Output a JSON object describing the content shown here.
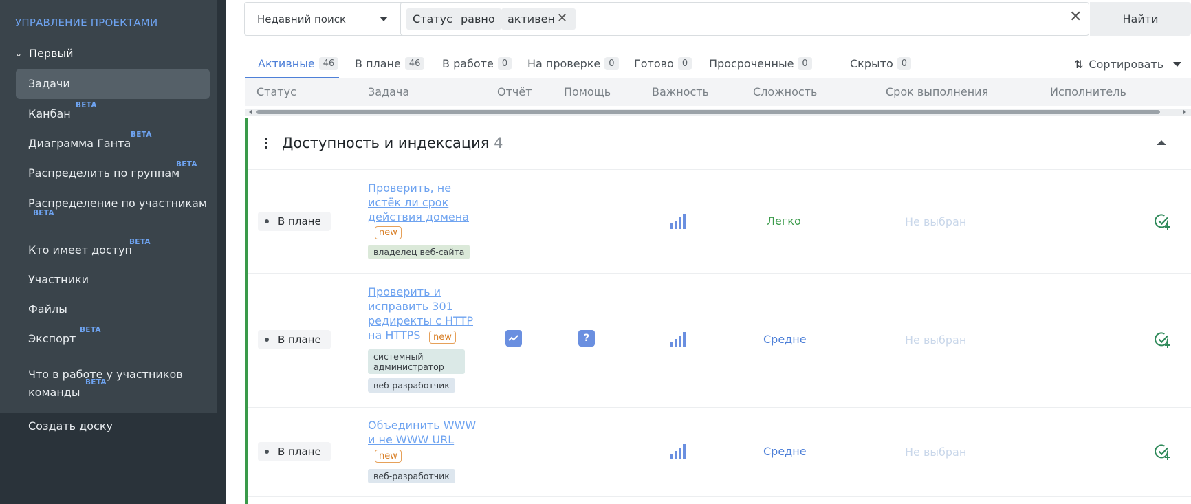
{
  "sidebar": {
    "title": "УПРАВЛЕНИЕ ПРОЕКТАМИ",
    "project": "Первый",
    "beta_label": "BETA",
    "items": [
      {
        "label": "Задачи",
        "beta": false
      },
      {
        "label": "Канбан",
        "beta": true
      },
      {
        "label": "Диаграмма Ганта",
        "beta": true
      },
      {
        "label": "Распределить по группам",
        "beta": true
      },
      {
        "label": "Распределение по участникам",
        "beta": true
      },
      {
        "label": "Кто имеет доступ",
        "beta": true
      },
      {
        "label": "Участники",
        "beta": false
      },
      {
        "label": "Файлы",
        "beta": false
      },
      {
        "label": "Экспорт",
        "beta": true
      },
      {
        "label": "Что в работе у участников команды",
        "beta": true
      }
    ],
    "create_board": "Создать доску"
  },
  "search": {
    "recent_label": "Недавний поиск",
    "chips": [
      "Статус",
      "равно",
      "активен"
    ],
    "find_button": "Найти"
  },
  "tabs": [
    {
      "label": "Активные",
      "count": "46"
    },
    {
      "label": "В плане",
      "count": "46"
    },
    {
      "label": "В работе",
      "count": "0"
    },
    {
      "label": "На проверке",
      "count": "0"
    },
    {
      "label": "Готово",
      "count": "0"
    },
    {
      "label": "Просроченные",
      "count": "0"
    },
    {
      "label": "Скрыто",
      "count": "0"
    }
  ],
  "sort_label": "Сортировать",
  "columns": [
    "Статус",
    "Задача",
    "Отчёт",
    "Помощь",
    "Важность",
    "Сложность",
    "Срок выполнения",
    "Исполнитель"
  ],
  "group": {
    "title": "Доступность и индексация",
    "count": "4"
  },
  "new_label": "new",
  "rows": [
    {
      "status": "В плане",
      "task_lines": [
        "Проверить, не",
        "истёк ли срок",
        "действия домена"
      ],
      "tags": [
        "владелец веб-сайта"
      ],
      "complexity": "Легко",
      "deadline": "Не выбран"
    },
    {
      "status": "В плане",
      "task_lines": [
        "Проверить и",
        "исправить 301",
        "редиректы с HTTP",
        "на HTTPS"
      ],
      "tags": [
        "системный администратор",
        "веб-разработчик"
      ],
      "complexity": "Средне",
      "deadline": "Не выбран"
    },
    {
      "status": "В плане",
      "task_lines": [
        "Объединить WWW",
        "и не WWW URL"
      ],
      "tags": [
        "веб-разработчик"
      ],
      "complexity": "Средне",
      "deadline": "Не выбран"
    }
  ],
  "colors": {
    "accent": "#4e80d8",
    "group_border": "#3a9a4a",
    "easy": "#3a9a4a",
    "medium": "#4e80d8",
    "new_badge": "#d9822b"
  }
}
